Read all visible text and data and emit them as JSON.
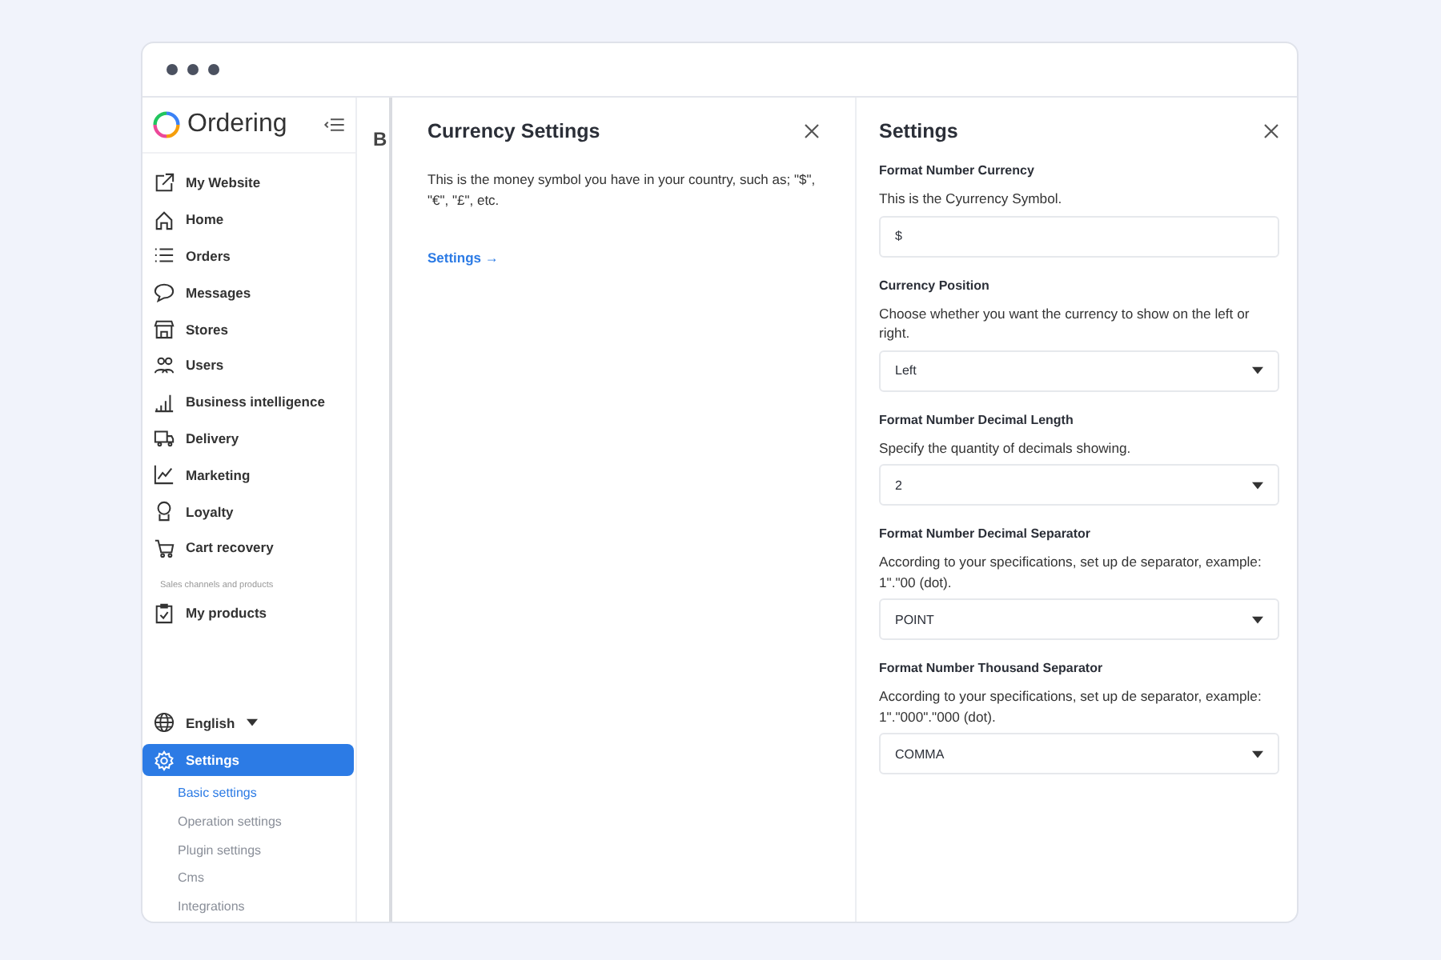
{
  "brand": {
    "name": "Ordering"
  },
  "nav": [
    {
      "label": "My Website",
      "selected": false
    },
    {
      "label": "Home",
      "selected": false
    },
    {
      "label": "Orders",
      "selected": false
    },
    {
      "label": "Messages",
      "selected": false
    },
    {
      "label": "Stores",
      "selected": false
    },
    {
      "label": "Users",
      "selected": false
    },
    {
      "label": "Business intelligence",
      "selected": false
    },
    {
      "label": "Delivery",
      "selected": false
    },
    {
      "label": "Marketing",
      "selected": false
    },
    {
      "label": "Loyalty",
      "selected": false
    },
    {
      "label": "Cart recovery",
      "selected": false
    }
  ],
  "section_label": "Sales channels and products",
  "section_items": [
    {
      "label": "My products",
      "selected": false
    }
  ],
  "language": "English",
  "settings_item": {
    "label": "Settings",
    "selected": true
  },
  "sub_items": [
    {
      "label": "Basic settings",
      "selected": true
    },
    {
      "label": "Operation settings",
      "selected": false
    },
    {
      "label": "Plugin settings",
      "selected": false
    },
    {
      "label": "Cms",
      "selected": false
    },
    {
      "label": "Integrations",
      "selected": false
    }
  ],
  "background_heading": "B",
  "currency_panel": {
    "title": "Currency Settings",
    "description": "This is the money symbol you have in your country, such as; \"$\", \"€\", \"£\", etc.",
    "link": "Settings →"
  },
  "settings_panel": {
    "title": "Settings",
    "fields": [
      {
        "kind": "input",
        "label": "Format Number Currency",
        "help": "This is the Cyurrency Symbol.",
        "value": "$"
      },
      {
        "kind": "select",
        "label": "Currency Position",
        "help": "Choose whether you want the currency to show on the left or right.",
        "value": "Left"
      },
      {
        "kind": "select",
        "label": "Format Number Decimal Length",
        "help": "Specify the quantity of decimals showing.",
        "value": "2"
      },
      {
        "kind": "select",
        "label": "Format Number Decimal Separator",
        "help": "According to your specifications, set up de separator, example: 1\".\"00 (dot).",
        "value": "POINT"
      },
      {
        "kind": "select",
        "label": "Format Number Thousand Separator",
        "help": "According to your specifications, set up de separator, example: 1\".\"000\".\"000 (dot).",
        "value": "COMMA"
      }
    ]
  }
}
